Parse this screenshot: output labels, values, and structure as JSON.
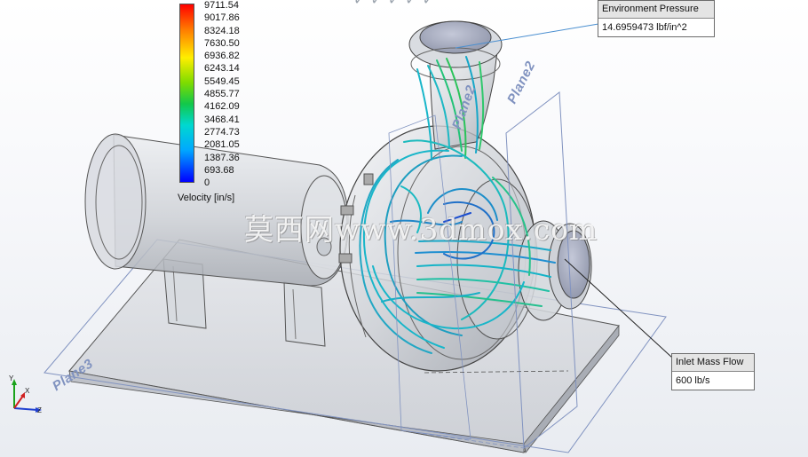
{
  "legend": {
    "ticks": [
      "9711.54",
      "9017.86",
      "8324.18",
      "7630.50",
      "6936.82",
      "6243.14",
      "5549.45",
      "4855.77",
      "4162.09",
      "3468.41",
      "2774.73",
      "2081.05",
      "1387.36",
      "693.68",
      "0"
    ],
    "title": "Velocity [in/s]",
    "colors": [
      "#ff0000",
      "#ff7a00",
      "#ffee00",
      "#7fdc00",
      "#12c84a",
      "#00d8d0",
      "#00a8ff",
      "#0000ff"
    ]
  },
  "callouts": {
    "environment": {
      "title": "Environment Pressure",
      "value": "14.6959473 lbf/in^2"
    },
    "inlet": {
      "title": "Inlet Mass Flow",
      "value": "600 lb/s"
    }
  },
  "planes": {
    "plane2": "Plane2",
    "plane2b": "Plane2",
    "plane3": "Plane3"
  },
  "watermark": "莫西网www.3dmox.com",
  "triad": {
    "y": "Y",
    "x": "X",
    "z": "Z"
  },
  "colors": {
    "plane": "#8193c0",
    "flow": "#18b6c9",
    "flow_dark": "#1e7d9a",
    "body": "#c9ccd2"
  }
}
